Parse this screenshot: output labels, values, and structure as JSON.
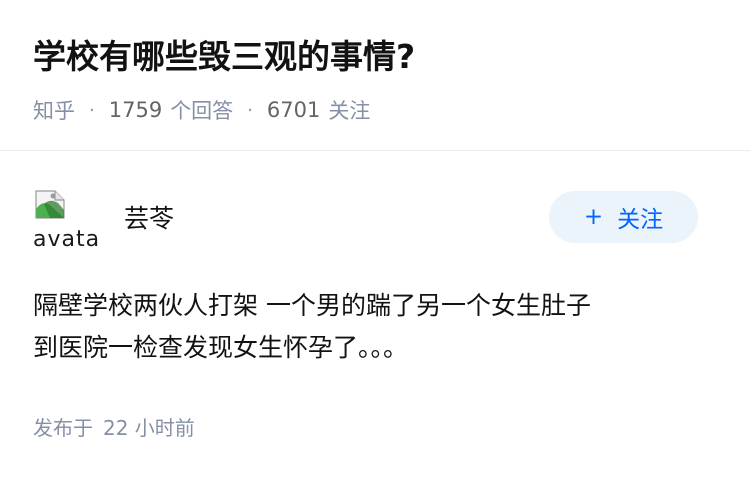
{
  "question": {
    "title": "学校有哪些毁三观的事情?",
    "source": "知乎",
    "answer_count": "1759",
    "answer_label": "个回答",
    "follower_count": "6701",
    "follower_label": "关注"
  },
  "answer": {
    "avatar_alt": "avatar",
    "author_name": "芸苓",
    "follow_button": {
      "icon": "plus-icon",
      "plus": "+",
      "label": "关注"
    },
    "content_lines": [
      "隔壁学校两伙人打架 一个男的踹了另一个女生肚子",
      "到医院一检查发现女生怀孕了。。。"
    ],
    "published_label": "发布于",
    "published_time": "22 小时前"
  },
  "colors": {
    "muted": "#8590a6",
    "accent": "#0066ff",
    "button_bg": "#ebf3fb"
  }
}
